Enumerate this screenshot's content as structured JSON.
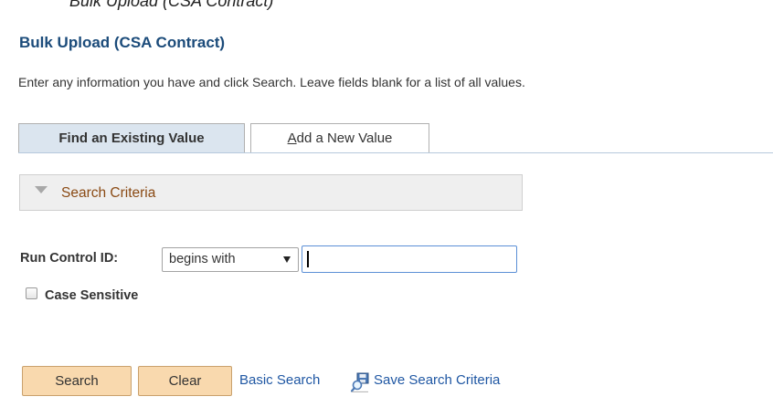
{
  "header": {
    "cut_text": "Bulk Upload (CSA Contract)",
    "title": "Bulk Upload (CSA Contract)",
    "instructions": "Enter any information you have and click Search. Leave fields blank for a list of all values."
  },
  "tabs": {
    "find_label": "Find an Existing Value",
    "add_prefix": "A",
    "add_rest": "dd a New Value",
    "active": "Find an Existing Value"
  },
  "search_criteria": {
    "section_label": "Search Criteria",
    "run_control_label": "Run Control ID:",
    "operator_selected": "begins with",
    "run_control_value": "",
    "case_sensitive_label": "Case Sensitive",
    "case_sensitive_checked": false
  },
  "actions": {
    "search_label": "Search",
    "clear_label": "Clear",
    "basic_search_label": "Basic Search",
    "save_search_label": "Save Search Criteria"
  },
  "colors": {
    "title": "#1b4b7a",
    "section_label": "#8a4a14",
    "link": "#1f57a3",
    "button_bg": "#f9d9ae",
    "active_tab_bg": "#dbe5ef",
    "input_border": "#5b8fd6"
  },
  "icons": {
    "collapse": "triangle-down-icon",
    "dropdown": "chevron-down-icon",
    "save_search": "save-search-icon"
  }
}
